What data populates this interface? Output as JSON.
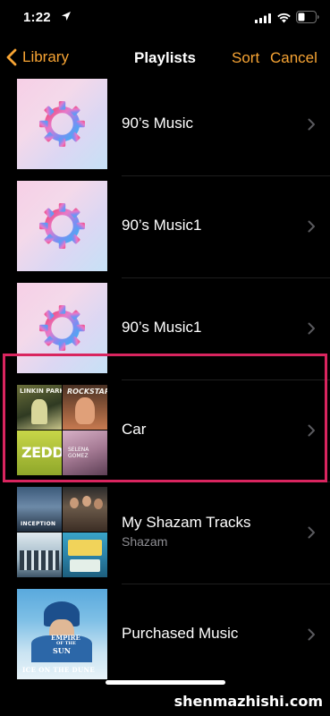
{
  "status_bar": {
    "time": "1:22"
  },
  "nav": {
    "back_label": "Library",
    "title": "Playlists",
    "sort_label": "Sort",
    "cancel_label": "Cancel"
  },
  "playlists": [
    {
      "title": "90’s Music"
    },
    {
      "title": "90’s Music1"
    },
    {
      "title": "90’s Music1"
    },
    {
      "title": "Car",
      "artwork": {
        "tile1": "LINKIN PARK",
        "tile2": "ROCKSTAR",
        "tile3": "ZEDD",
        "tile4": "SELENA GOMEZ"
      }
    },
    {
      "title": "My Shazam Tracks",
      "subtitle": "Shazam",
      "artwork": {
        "tile1": "INCEPTION"
      }
    },
    {
      "title": "Purchased Music",
      "artwork": {
        "line1": "EMPIRE",
        "line2": "OF THE",
        "line3": "SUN",
        "line4": "ICE ON THE DUNE"
      }
    }
  ],
  "colors": {
    "accent": "#f7a434",
    "highlight": "#d9255f",
    "background": "#000000"
  },
  "watermark": "shenmazhishi.com"
}
